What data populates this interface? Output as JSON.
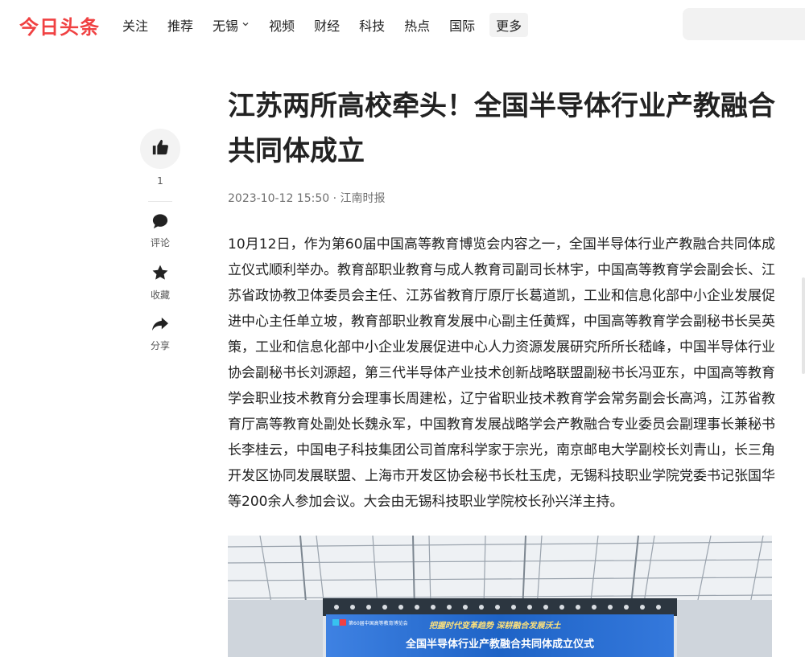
{
  "header": {
    "logo": "今日头条",
    "nav": [
      {
        "label": "关注"
      },
      {
        "label": "推荐"
      },
      {
        "label": "无锡"
      },
      {
        "label": "视频"
      },
      {
        "label": "财经"
      },
      {
        "label": "科技"
      },
      {
        "label": "热点"
      },
      {
        "label": "国际"
      }
    ],
    "more_label": "更多"
  },
  "side": {
    "like_count": "1",
    "comment_label": "评论",
    "favorite_label": "收藏",
    "share_label": "分享"
  },
  "article": {
    "title": "江苏两所高校牵头！全国半导体行业产教融合共同体成立",
    "date": "2023-10-12 15:50",
    "source": "江南时报",
    "paragraph": "10月12日，作为第60届中国高等教育博览会内容之一，全国半导体行业产教融合共同体成立仪式顺利举办。教育部职业教育与成人教育司副司长林宇，中国高等教育学会副会长、江苏省政协教卫体委员会主任、江苏省教育厅原厅长葛道凯，工业和信息化部中小企业发展促进中心主任单立坡，教育部职业教育发展中心副主任黄辉，中国高等教育学会副秘书长吴英策，工业和信息化部中小企业发展促进中心人力资源发展研究所所长嵇峰，中国半导体行业协会副秘书长刘源超，第三代半导体产业技术创新战略联盟副秘书长冯亚东，中国高等教育学会职业技术教育分会理事长周建松，辽宁省职业技术教育学会常务副会长高鸿，江苏省教育厅高等教育处副处长魏永军，中国教育发展战略学会产教融合专业委员会副理事长兼秘书长李桂云，中国电子科技集团公司首席科学家于宗光，南京邮电大学副校长刘青山，长三角开发区协同发展联盟、上海市开发区协会秘书长杜玉虎，无锡科技职业学院党委书记张国华等200余人参加会议。大会由无锡科技职业学院校长孙兴洋主持。"
  },
  "photo": {
    "banner_slogan": "把握时代变革趋势  深耕融合发展沃土",
    "banner_title": "全国半导体行业产教融合共同体成立仪式",
    "banner_logo_text": "第60届中国高等教育博览会"
  },
  "colors": {
    "brand": "#f04142",
    "banner_blue": "#1e63c6"
  }
}
